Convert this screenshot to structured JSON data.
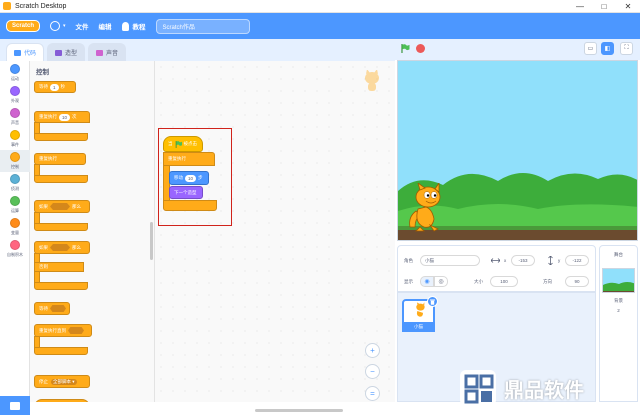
{
  "window": {
    "title": "Scratch Desktop",
    "controls": [
      "—",
      "□",
      "✕"
    ]
  },
  "menubar": {
    "logo": "Scratch",
    "file_label": "文件",
    "edit_label": "编辑",
    "tutorials_label": "教程",
    "project_title": "Scratch作品",
    "language_caret": "▾"
  },
  "tabs": [
    {
      "label": "代码",
      "active": true
    },
    {
      "label": "造型",
      "active": false
    },
    {
      "label": "声音",
      "active": false
    }
  ],
  "categories": [
    {
      "label": "运动",
      "color": "#4c97ff"
    },
    {
      "label": "外观",
      "color": "#9966ff"
    },
    {
      "label": "声音",
      "color": "#cf63cf"
    },
    {
      "label": "事件",
      "color": "#ffbf00"
    },
    {
      "label": "控制",
      "color": "#ffab19"
    },
    {
      "label": "侦测",
      "color": "#5cb1d6"
    },
    {
      "label": "运算",
      "color": "#59c059"
    },
    {
      "label": "变量",
      "color": "#ff8c1a"
    },
    {
      "label": "自制积木",
      "color": "#ff6680"
    }
  ],
  "palette": {
    "heading": "控制",
    "wait": {
      "text": "等待",
      "value": "1",
      "unit": "秒"
    },
    "repeat": {
      "text": "重复执行",
      "value": "10",
      "unit": "次"
    },
    "forever": {
      "text": "重复执行"
    },
    "if_then": {
      "if": "如果",
      "then": "那么"
    },
    "if_else": {
      "if": "如果",
      "then": "那么",
      "else": "否则"
    },
    "wait_until": {
      "text": "等待"
    },
    "repeat_until": {
      "text": "重复执行直到"
    },
    "stop": {
      "text": "停止",
      "option": "全部脚本 ▾"
    }
  },
  "script": {
    "hat": {
      "prefix": "当",
      "suffix": "被点击"
    },
    "forever": "重复执行",
    "move": {
      "text": "移动",
      "value": "10",
      "unit": "步"
    },
    "next_costume": "下一个造型"
  },
  "zoom": {
    "in": "+",
    "out": "−",
    "reset": "="
  },
  "stage_controls": {
    "small_stage": "▭",
    "large_stage": "◧",
    "fullscreen": "⛶"
  },
  "sprite_info": {
    "sprite_label": "角色",
    "sprite_name": "小猫",
    "x_label": "x",
    "x_value": "-153",
    "y_label": "y",
    "y_value": "-122",
    "show_label": "显示",
    "size_label": "大小",
    "size_value": "100",
    "direction_label": "方向",
    "direction_value": "90"
  },
  "sprite_list": {
    "tiles": [
      {
        "name": "小猫",
        "selected": true
      }
    ]
  },
  "stage_pane": {
    "title": "舞台",
    "backdrops_label": "背景",
    "backdrops_count": "2"
  },
  "watermark": {
    "text": "鼎品软件"
  },
  "colors": {
    "scratch_blue": "#4c97ff",
    "control_orange": "#ffab19",
    "motion_blue": "#4c97ff",
    "looks_purple": "#9966ff",
    "highlight_red": "#d0231b",
    "sky": "#90e0fb",
    "grass": "#3dad3b",
    "ground": "#6b4b2f"
  },
  "icons": {
    "window_app": "scratch-cat-icon",
    "language": "globe-icon",
    "tutorials": "lightbulb-icon",
    "code_tab": "code-icon",
    "costume_tab": "paintbrush-icon",
    "sound_tab": "speaker-icon",
    "green_flag": "green-flag-icon",
    "stop": "stop-icon",
    "extension": "add-extension-icon",
    "delete_sprite": "trash-icon"
  }
}
